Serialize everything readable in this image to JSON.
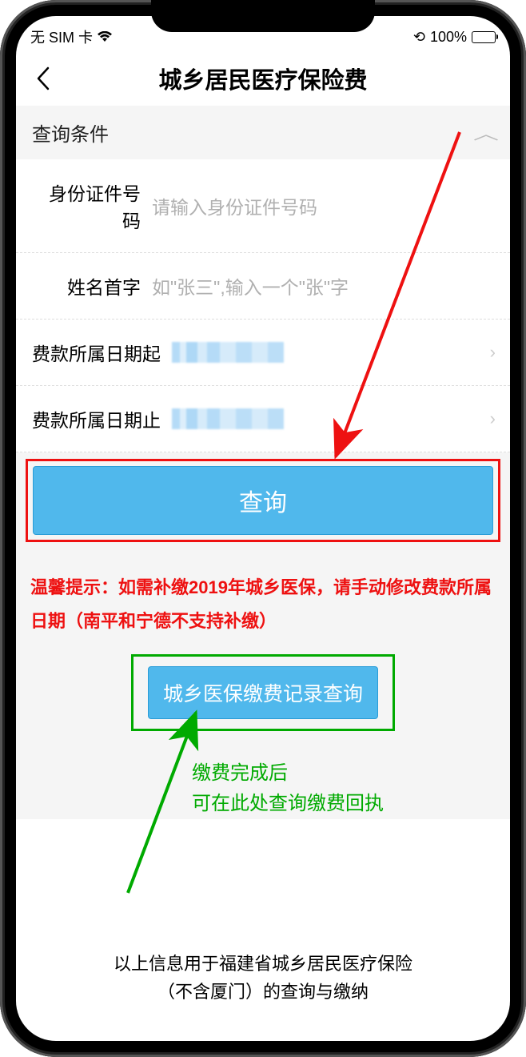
{
  "status": {
    "carrier": "无 SIM 卡",
    "battery": "100%"
  },
  "nav": {
    "title": "城乡居民医疗保险费"
  },
  "section": {
    "title": "查询条件"
  },
  "form": {
    "id": {
      "label": "身份证件号码",
      "placeholder": "请输入身份证件号码"
    },
    "name": {
      "label": "姓名首字",
      "placeholder": "如\"张三\",输入一个\"张\"字"
    },
    "dateFrom": {
      "label": "费款所属日期起"
    },
    "dateTo": {
      "label": "费款所属日期止"
    }
  },
  "buttons": {
    "query": "查询",
    "record": "城乡医保缴费记录查询"
  },
  "tip": "温馨提示：如需补缴2019年城乡医保，请手动修改费款所属日期（南平和宁德不支持补缴）",
  "greenNote": {
    "l1": "缴费完成后",
    "l2": "可在此处查询缴费回执"
  },
  "footer": {
    "l1": "以上信息用于福建省城乡居民医疗保险",
    "l2": "（不含厦门）的查询与缴纳"
  }
}
